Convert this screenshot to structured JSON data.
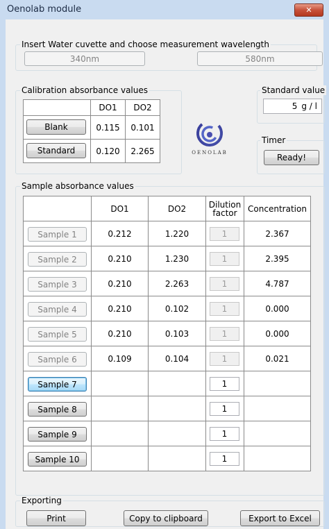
{
  "window": {
    "title": "Oenolab module",
    "close_label": "✕"
  },
  "wavelength": {
    "legend": "Insert Water cuvette and choose measurement wavelength",
    "btn_340": "340nm",
    "btn_580": "580nm"
  },
  "calibration": {
    "legend": "Calibration absorbance values",
    "headers": [
      "",
      "DO1",
      "DO2"
    ],
    "rows": [
      {
        "label": "Blank",
        "do1": "0.115",
        "do2": "0.101"
      },
      {
        "label": "Standard",
        "do1": "0.120",
        "do2": "2.265"
      }
    ]
  },
  "logo": {
    "text": "OENOLAB"
  },
  "standard_value": {
    "legend": "Standard value",
    "value": "5",
    "unit": "g / l"
  },
  "timer": {
    "legend": "Timer",
    "button": "Ready!"
  },
  "samples": {
    "legend": "Sample absorbance values",
    "headers": {
      "do1": "DO1",
      "do2": "DO2",
      "dilution": "Dilution factor",
      "conc": "Concentration"
    },
    "rows": [
      {
        "label": "Sample 1",
        "do1": "0.212",
        "do2": "1.220",
        "dilution": "1",
        "conc": "2.367"
      },
      {
        "label": "Sample 2",
        "do1": "0.210",
        "do2": "1.230",
        "dilution": "1",
        "conc": "2.395"
      },
      {
        "label": "Sample 3",
        "do1": "0.210",
        "do2": "2.263",
        "dilution": "1",
        "conc": "4.787"
      },
      {
        "label": "Sample 4",
        "do1": "0.210",
        "do2": "0.102",
        "dilution": "1",
        "conc": "0.000"
      },
      {
        "label": "Sample 5",
        "do1": "0.210",
        "do2": "0.103",
        "dilution": "1",
        "conc": "0.000"
      },
      {
        "label": "Sample 6",
        "do1": "0.109",
        "do2": "0.104",
        "dilution": "1",
        "conc": "0.021"
      },
      {
        "label": "Sample 7",
        "do1": "",
        "do2": "",
        "dilution": "1",
        "conc": ""
      },
      {
        "label": "Sample 8",
        "do1": "",
        "do2": "",
        "dilution": "1",
        "conc": ""
      },
      {
        "label": "Sample 9",
        "do1": "",
        "do2": "",
        "dilution": "1",
        "conc": ""
      },
      {
        "label": "Sample 10",
        "do1": "",
        "do2": "",
        "dilution": "1",
        "conc": ""
      }
    ]
  },
  "exporting": {
    "legend": "Exporting",
    "print": "Print",
    "copy": "Copy to clipboard",
    "excel": "Export to Excel"
  }
}
